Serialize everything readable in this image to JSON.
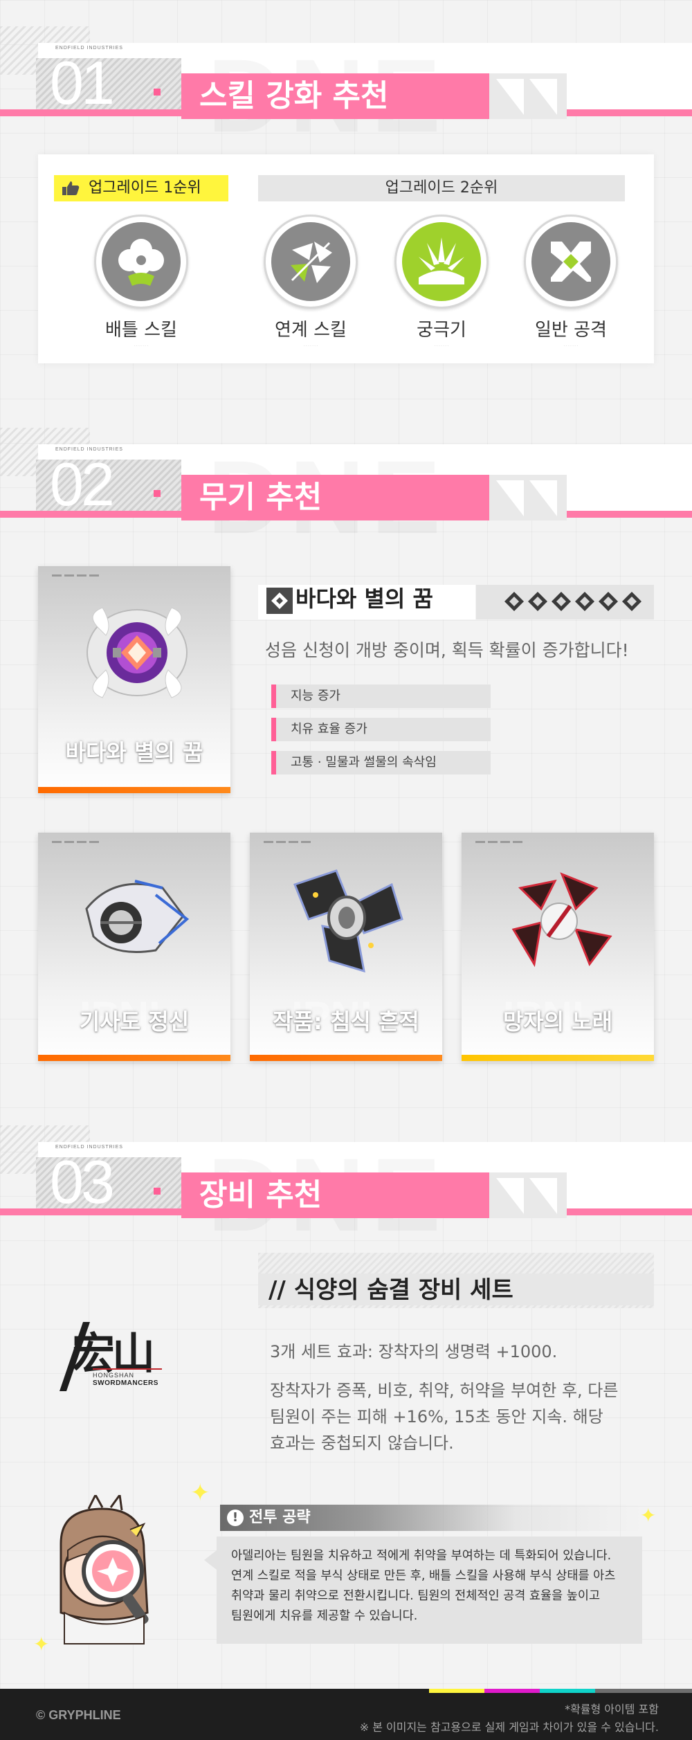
{
  "sections": [
    {
      "number": "01",
      "title": "스킬 강화 추천",
      "small_left": "ENDFIELD INDUSTRIES"
    },
    {
      "number": "02",
      "title": "무기 추천",
      "small_left": "ENDFIELD INDUSTRIES"
    },
    {
      "number": "03",
      "title": "장비 추천",
      "small_left": "ENDFIELD INDUSTRIES"
    }
  ],
  "skills": {
    "first_priority_label": "업그레이드 1순위",
    "second_priority_label": "업그레이드 2순위",
    "items": [
      {
        "name": "배틀 스킬",
        "icon": "flower-icon"
      },
      {
        "name": "연계 스킬",
        "icon": "shatter-icon"
      },
      {
        "name": "궁극기",
        "icon": "burst-icon"
      },
      {
        "name": "일반 공격",
        "icon": "cross-icon"
      }
    ]
  },
  "weapons": {
    "featured": {
      "name": "바다와 별의 꿈",
      "card_label": "바다와 별의 꿈",
      "description": "성음 신청이 개방 중이며, 획득 확률이 증가합니다!",
      "rarity_stars": 6,
      "stats": [
        "지능 증가",
        "치유 효율 증가",
        "고통 · 밀물과 썰물의 속삭임"
      ]
    },
    "alternatives": [
      {
        "name": "기사도 정신",
        "bar": "orange"
      },
      {
        "name": "작품: 침식 흔적",
        "bar": "orange"
      },
      {
        "name": "망자의 노래",
        "bar": "yellow"
      }
    ]
  },
  "gear": {
    "set_title_prefix": "//",
    "set_title": "식양의 숨결 장비 세트",
    "logo_text": "宏山",
    "logo_sub1": "HONGSHAN",
    "logo_sub2": "SWORDMANCERS",
    "effect_line1": "3개 세트 효과: 장착자의 생명력 +1000.",
    "effect_line2": "장착자가 증폭, 비호, 취약, 허약을 부여한 후, 다른",
    "effect_line3": "팀원이 주는 피해 +16%, 15초 동안 지속. 해당",
    "effect_line4": "효과는 중첩되지 않습니다."
  },
  "tip": {
    "title": "전투 공략",
    "lines": [
      "아델리아는 팀원을 치유하고 적에게 취약을 부여하는 데 특화되어 있습니다.",
      "연계 스킬로 적을 부식 상태로 만든 후, 배틀 스킬을 사용해 부식 상태를 아츠",
      "취약과 물리 취약으로 전환시킵니다. 팀원의 전체적인 공격 효율을 높이고",
      "팀원에게 치유를 제공할 수 있습니다."
    ]
  },
  "footer": {
    "copyright": "© GRYPHLINE",
    "note1": "*확률형 아이템 포함",
    "note2": "※ 본 이미지는 참고용으로 실제 게임과 차이가 있을 수 있습니다."
  },
  "colors": {
    "pink": "#ff7aa8",
    "yellow": "#fff53d",
    "green": "#9fd12c",
    "orange": "#ff6a00"
  }
}
